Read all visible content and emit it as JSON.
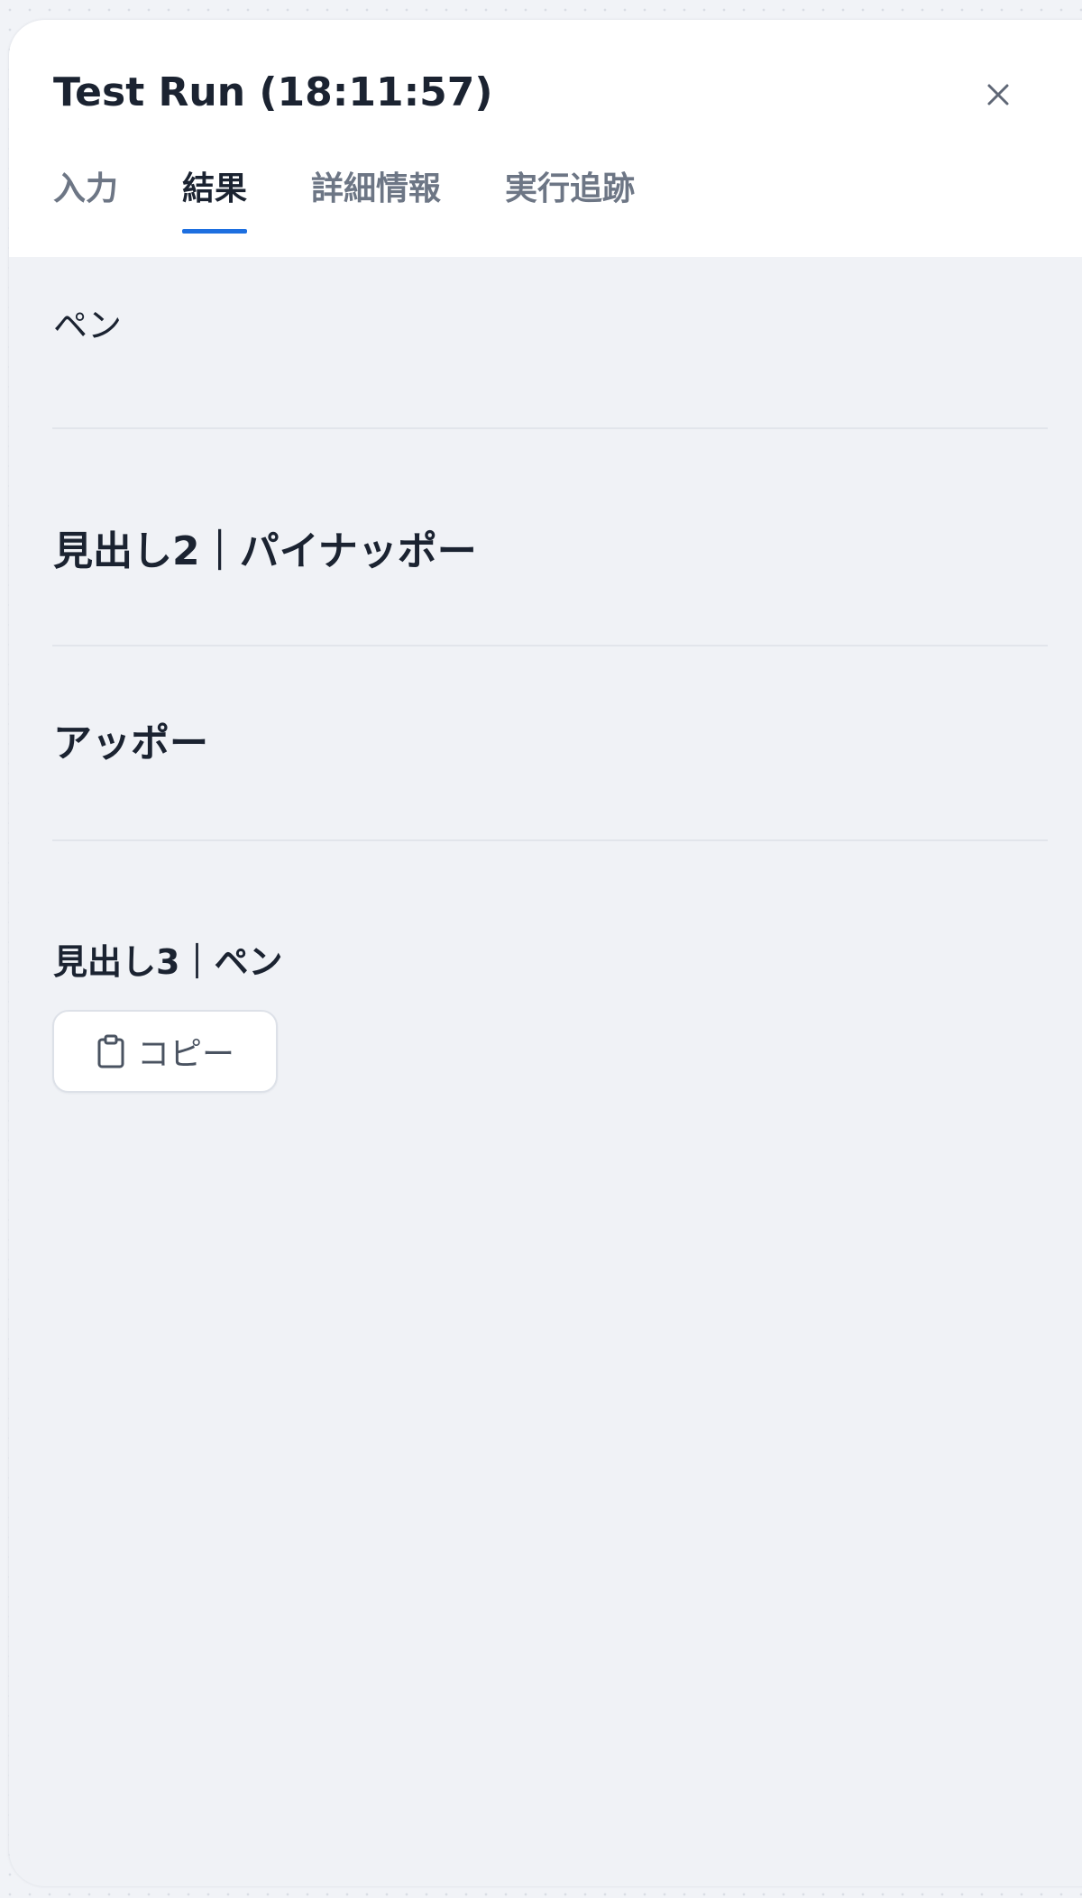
{
  "panel": {
    "title": "Test Run (18:11:57)",
    "close_icon": "close-icon"
  },
  "tabs": [
    {
      "label": "入力",
      "active": false
    },
    {
      "label": "結果",
      "active": true
    },
    {
      "label": "詳細情報",
      "active": false
    },
    {
      "label": "実行追跡",
      "active": false
    }
  ],
  "results": {
    "line1": "ペン",
    "line2": "見出し2｜パイナッポー",
    "line3": "アッポー",
    "line4": "見出し3｜ペン"
  },
  "copy_button": {
    "icon": "clipboard-icon",
    "label": "コピー"
  },
  "colors": {
    "accent": "#1d6fe0",
    "text": "#1b2331",
    "muted": "#6d7685",
    "panel_bg": "#f0f2f6"
  }
}
